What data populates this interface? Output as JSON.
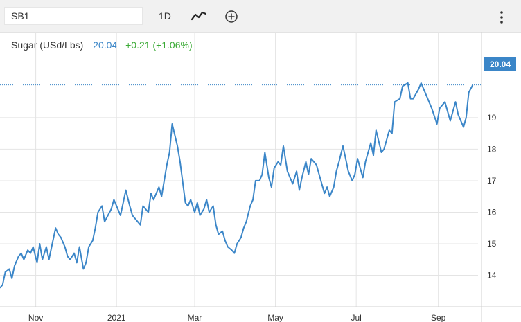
{
  "toolbar": {
    "symbol": "SB1",
    "interval": "1D",
    "icons": [
      "line-chart-icon",
      "add-indicator-icon",
      "more-options-icon"
    ]
  },
  "legend": {
    "name": "Sugar (USd/Lbs)",
    "price": "20.04",
    "change": "+0.21 (+1.06%)"
  },
  "last_price_tag": "20.04",
  "colors": {
    "line": "#3b86c8",
    "up": "#3aaa35",
    "grid": "#e4e4e4"
  },
  "chart_data": {
    "type": "line",
    "title": "",
    "xlabel": "",
    "ylabel": "",
    "x_tick_labels": [
      "Nov",
      "2021",
      "Mar",
      "May",
      "Jul",
      "Sep"
    ],
    "x_tick_dates": [
      "2020-11-01",
      "2021-01-01",
      "2021-03-01",
      "2021-05-01",
      "2021-07-01",
      "2021-09-01"
    ],
    "y_tick_labels": [
      "14",
      "15",
      "16",
      "17",
      "18",
      "19"
    ],
    "ylim": [
      13,
      20.8
    ],
    "xlim": [
      "2020-10-05",
      "2021-10-01"
    ],
    "grid": true,
    "series": [
      {
        "name": "",
        "points": [
          [
            "2020-10-05",
            13.6
          ],
          [
            "2020-10-07",
            13.7
          ],
          [
            "2020-10-09",
            14.1
          ],
          [
            "2020-10-12",
            14.2
          ],
          [
            "2020-10-14",
            13.9
          ],
          [
            "2020-10-16",
            14.3
          ],
          [
            "2020-10-19",
            14.6
          ],
          [
            "2020-10-21",
            14.7
          ],
          [
            "2020-10-23",
            14.5
          ],
          [
            "2020-10-26",
            14.8
          ],
          [
            "2020-10-28",
            14.7
          ],
          [
            "2020-10-30",
            14.9
          ],
          [
            "2020-11-02",
            14.4
          ],
          [
            "2020-11-04",
            15.0
          ],
          [
            "2020-11-06",
            14.5
          ],
          [
            "2020-11-09",
            14.9
          ],
          [
            "2020-11-11",
            14.5
          ],
          [
            "2020-11-13",
            14.9
          ],
          [
            "2020-11-16",
            15.5
          ],
          [
            "2020-11-18",
            15.3
          ],
          [
            "2020-11-20",
            15.2
          ],
          [
            "2020-11-23",
            14.9
          ],
          [
            "2020-11-25",
            14.6
          ],
          [
            "2020-11-27",
            14.5
          ],
          [
            "2020-11-30",
            14.7
          ],
          [
            "2020-12-02",
            14.4
          ],
          [
            "2020-12-04",
            14.9
          ],
          [
            "2020-12-07",
            14.2
          ],
          [
            "2020-12-09",
            14.4
          ],
          [
            "2020-12-11",
            14.9
          ],
          [
            "2020-12-14",
            15.1
          ],
          [
            "2020-12-16",
            15.5
          ],
          [
            "2020-12-18",
            16.0
          ],
          [
            "2020-12-21",
            16.2
          ],
          [
            "2020-12-23",
            15.7
          ],
          [
            "2020-12-28",
            16.1
          ],
          [
            "2020-12-30",
            16.4
          ],
          [
            "2021-01-04",
            15.9
          ],
          [
            "2021-01-06",
            16.3
          ],
          [
            "2021-01-08",
            16.7
          ],
          [
            "2021-01-11",
            16.2
          ],
          [
            "2021-01-13",
            15.9
          ],
          [
            "2021-01-15",
            15.8
          ],
          [
            "2021-01-19",
            15.6
          ],
          [
            "2021-01-21",
            16.2
          ],
          [
            "2021-01-25",
            16.0
          ],
          [
            "2021-01-27",
            16.6
          ],
          [
            "2021-01-29",
            16.4
          ],
          [
            "2021-02-02",
            16.8
          ],
          [
            "2021-02-04",
            16.5
          ],
          [
            "2021-02-08",
            17.5
          ],
          [
            "2021-02-10",
            17.9
          ],
          [
            "2021-02-12",
            18.8
          ],
          [
            "2021-02-16",
            18.1
          ],
          [
            "2021-02-18",
            17.6
          ],
          [
            "2021-02-22",
            16.3
          ],
          [
            "2021-02-24",
            16.2
          ],
          [
            "2021-02-26",
            16.4
          ],
          [
            "2021-03-01",
            16.0
          ],
          [
            "2021-03-03",
            16.3
          ],
          [
            "2021-03-05",
            15.9
          ],
          [
            "2021-03-08",
            16.1
          ],
          [
            "2021-03-10",
            16.4
          ],
          [
            "2021-03-12",
            16.0
          ],
          [
            "2021-03-15",
            16.2
          ],
          [
            "2021-03-17",
            15.6
          ],
          [
            "2021-03-19",
            15.3
          ],
          [
            "2021-03-22",
            15.4
          ],
          [
            "2021-03-24",
            15.1
          ],
          [
            "2021-03-26",
            14.9
          ],
          [
            "2021-03-29",
            14.8
          ],
          [
            "2021-03-31",
            14.7
          ],
          [
            "2021-04-02",
            15.0
          ],
          [
            "2021-04-05",
            15.2
          ],
          [
            "2021-04-07",
            15.5
          ],
          [
            "2021-04-09",
            15.7
          ],
          [
            "2021-04-12",
            16.2
          ],
          [
            "2021-04-14",
            16.4
          ],
          [
            "2021-04-16",
            17.0
          ],
          [
            "2021-04-19",
            17.0
          ],
          [
            "2021-04-21",
            17.2
          ],
          [
            "2021-04-23",
            17.9
          ],
          [
            "2021-04-26",
            17.1
          ],
          [
            "2021-04-28",
            16.8
          ],
          [
            "2021-04-30",
            17.4
          ],
          [
            "2021-05-03",
            17.6
          ],
          [
            "2021-05-05",
            17.5
          ],
          [
            "2021-05-07",
            18.1
          ],
          [
            "2021-05-10",
            17.3
          ],
          [
            "2021-05-12",
            17.1
          ],
          [
            "2021-05-14",
            16.9
          ],
          [
            "2021-05-17",
            17.3
          ],
          [
            "2021-05-19",
            16.7
          ],
          [
            "2021-05-21",
            17.1
          ],
          [
            "2021-05-24",
            17.6
          ],
          [
            "2021-05-26",
            17.2
          ],
          [
            "2021-05-28",
            17.7
          ],
          [
            "2021-06-01",
            17.5
          ],
          [
            "2021-06-03",
            17.2
          ],
          [
            "2021-06-07",
            16.6
          ],
          [
            "2021-06-09",
            16.8
          ],
          [
            "2021-06-11",
            16.5
          ],
          [
            "2021-06-14",
            16.8
          ],
          [
            "2021-06-16",
            17.3
          ],
          [
            "2021-06-18",
            17.6
          ],
          [
            "2021-06-21",
            18.1
          ],
          [
            "2021-06-23",
            17.7
          ],
          [
            "2021-06-25",
            17.3
          ],
          [
            "2021-06-28",
            17.0
          ],
          [
            "2021-06-30",
            17.2
          ],
          [
            "2021-07-02",
            17.7
          ],
          [
            "2021-07-06",
            17.1
          ],
          [
            "2021-07-08",
            17.6
          ],
          [
            "2021-07-12",
            18.2
          ],
          [
            "2021-07-14",
            17.8
          ],
          [
            "2021-07-16",
            18.6
          ],
          [
            "2021-07-20",
            17.9
          ],
          [
            "2021-07-22",
            18.0
          ],
          [
            "2021-07-26",
            18.6
          ],
          [
            "2021-07-28",
            18.5
          ],
          [
            "2021-07-30",
            19.5
          ],
          [
            "2021-08-03",
            19.6
          ],
          [
            "2021-08-05",
            20.0
          ],
          [
            "2021-08-09",
            20.1
          ],
          [
            "2021-08-11",
            19.6
          ],
          [
            "2021-08-13",
            19.6
          ],
          [
            "2021-08-17",
            19.9
          ],
          [
            "2021-08-19",
            20.1
          ],
          [
            "2021-08-23",
            19.7
          ],
          [
            "2021-08-25",
            19.5
          ],
          [
            "2021-08-27",
            19.3
          ],
          [
            "2021-08-31",
            18.8
          ],
          [
            "2021-09-02",
            19.3
          ],
          [
            "2021-09-06",
            19.5
          ],
          [
            "2021-09-08",
            19.2
          ],
          [
            "2021-09-10",
            18.9
          ],
          [
            "2021-09-14",
            19.5
          ],
          [
            "2021-09-16",
            19.1
          ],
          [
            "2021-09-20",
            18.7
          ],
          [
            "2021-09-22",
            19.0
          ],
          [
            "2021-09-24",
            19.8
          ],
          [
            "2021-09-27",
            20.04
          ]
        ]
      }
    ]
  }
}
